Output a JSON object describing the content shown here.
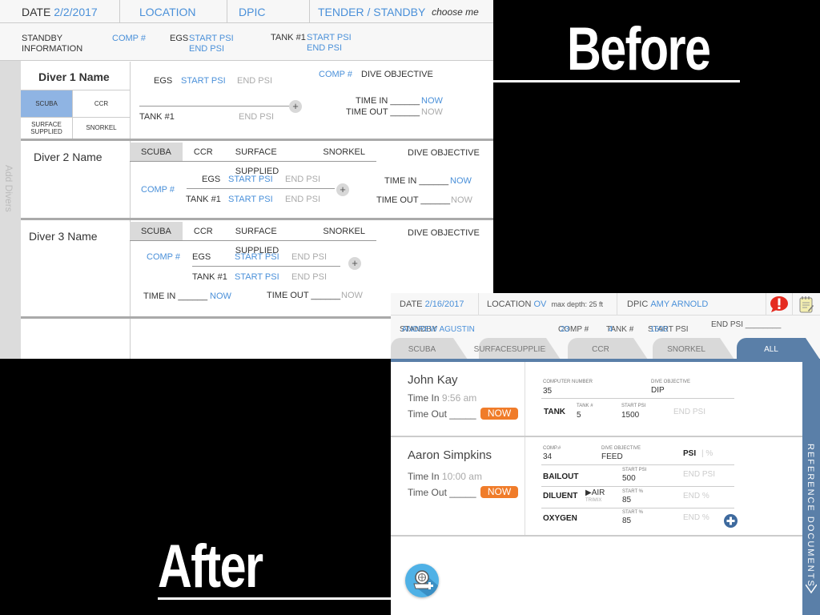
{
  "labels": {
    "before": "Before",
    "after": "After"
  },
  "before": {
    "header": {
      "date_label": "DATE",
      "date_value": "2/2/2017",
      "location": "LOCATION",
      "dpic": "DPIC",
      "tender": "TENDER / STANDBY",
      "choose": "choose me"
    },
    "standby": {
      "info_l1": "STANDBY",
      "info_l2": "INFORMATION",
      "comp": "COMP #",
      "egs": "EGS",
      "egs_start": "START PSI",
      "egs_end": "END PSI",
      "tank": "TANK #1",
      "tank_start": "START PSI",
      "tank_end": "END PSI"
    },
    "sidebar_label": "Add Divers",
    "modes": [
      "SCUBA",
      "CCR",
      "SURFACE SUPPLIED",
      "SNORKEL"
    ],
    "diver1": {
      "name": "Diver 1 Name",
      "mode_surface_l1": "SURFACE",
      "mode_surface_l2": "SUPPLIED",
      "egs": "EGS",
      "start": "START PSI",
      "end": "END PSI",
      "tank": "TANK #1",
      "tank_end": "END PSI",
      "comp": "COMP #",
      "objective": "DIVE OBJECTIVE",
      "time_in": "TIME IN ______",
      "time_out": "TIME OUT ______",
      "now_in": "NOW",
      "now_out": "NOW",
      "plus": "+"
    },
    "diver2": {
      "name": "Diver 2 Name",
      "objective": "DIVE OBJECTIVE",
      "comp": "COMP #",
      "egs": "EGS",
      "tank": "TANK #1",
      "start": "START PSI",
      "end": "END PSI",
      "time_in": "TIME IN ______",
      "time_out": "TIME OUT ______",
      "now_in": "NOW",
      "now_out": "NOW",
      "plus": "+"
    },
    "diver3": {
      "name": "Diver 3 Name",
      "objective": "DIVE OBJECTIVE",
      "comp": "COMP #",
      "egs": "EGS",
      "tank": "TANK #1",
      "start": "START PSI",
      "end": "END PSI",
      "time_in": "TIME IN ______",
      "time_out": "TIME OUT ______",
      "now_in": "NOW",
      "now_out": "NOW",
      "plus": "+"
    }
  },
  "after": {
    "header": {
      "date_label": "DATE",
      "date_value": "2/16/2017",
      "location_label": "LOCATION",
      "location_value": "OV",
      "max_depth": "max depth: 25 ft",
      "dpic_label": "DPIC",
      "dpic_value": "AMY ARNOLD",
      "alert_icon": "alert-icon",
      "notes_icon": "notepad-icon"
    },
    "standby": {
      "label": "STANDBY",
      "name": "ANDREW AGUSTIN",
      "comp_label": "COMP #",
      "comp_value": "23",
      "tank_label": "TANK #",
      "tank_value": "4",
      "start_label": "START PSI",
      "start_value": "1500",
      "end_label": "END PSI ________"
    },
    "tabs": [
      {
        "label": "SCUBA"
      },
      {
        "label_l1": "SURFACE",
        "label_l2": "SUPPLIED"
      },
      {
        "label": "CCR"
      },
      {
        "label": "SNORKEL"
      },
      {
        "label": "ALL",
        "selected": true
      }
    ],
    "reference": "REFERENCE DOCUMENTS",
    "divers": [
      {
        "name": "John Kay",
        "time_in_label": "Time In",
        "time_in": "9:56 am",
        "time_out_label": "Time Out _____",
        "now": "NOW",
        "computer_label": "COMPUTER NUMBER",
        "computer": "35",
        "objective_label": "DIVE OBJECTIVE",
        "objective": "DIP",
        "tank": "TANK",
        "tank_no_label": "TANK #",
        "tank_no": "5",
        "start_label": "START PSI",
        "start": "1500",
        "end": "END PSI"
      },
      {
        "name": "Aaron Simpkins",
        "time_in_label": "Time In",
        "time_in": "10:00 am",
        "time_out_label": "Time Out _____",
        "now": "NOW",
        "comp_label": "COMP.#",
        "comp": "34",
        "objective_label": "DIVE OBJECTIVE",
        "objective": "FEED",
        "psi": "PSI",
        "pct": "%",
        "bailout": "BAILOUT",
        "bailout_start_label": "START PSI",
        "bailout_start": "500",
        "bailout_end": "END PSI",
        "diluent": "DILUENT",
        "diluent_gas": "▶AIR",
        "diluent_alt": "TRIMIX",
        "diluent_start_label": "START %",
        "diluent_start": "85",
        "diluent_end": "END %",
        "oxygen": "OXYGEN",
        "oxygen_start_label": "START %",
        "oxygen_start": "85",
        "oxygen_end": "END %"
      }
    ],
    "colors": {
      "accent": "#5a7fa8",
      "now": "#f07c2a",
      "link": "#4a90d9"
    }
  }
}
